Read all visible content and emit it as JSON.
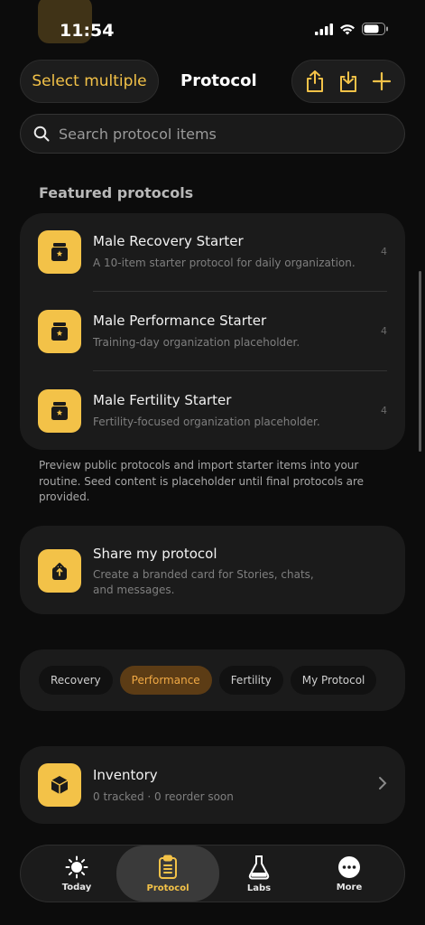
{
  "status": {
    "time": "11:54"
  },
  "header": {
    "select_label": "Select multiple",
    "title": "Protocol",
    "actions": [
      "share-icon",
      "download-icon",
      "plus-icon"
    ]
  },
  "search": {
    "placeholder": "Search protocol items"
  },
  "featured": {
    "title": "Featured protocols",
    "items": [
      {
        "name": "Male Recovery Starter",
        "desc": "A 10-item starter protocol for daily organization.",
        "count": "4"
      },
      {
        "name": "Male Performance Starter",
        "desc": "Training-day organization placeholder.",
        "count": "4"
      },
      {
        "name": "Male Fertility Starter",
        "desc": "Fertility-focused organization placeholder.",
        "count": "4"
      }
    ],
    "note": "Preview public protocols and import starter items into your routine. Seed content is placeholder until final protocols are provided."
  },
  "share": {
    "title": "Share my protocol",
    "desc": "Create a branded card for Stories, chats, and messages."
  },
  "filters": [
    "Recovery",
    "Performance",
    "Fertility",
    "My Protocol"
  ],
  "filters_active": "Performance",
  "inventory": {
    "title": "Inventory",
    "desc": "0 tracked · 0 reorder soon"
  },
  "tabs": [
    {
      "label": "Today",
      "icon": "sun-icon"
    },
    {
      "label": "Protocol",
      "icon": "clipboard-icon"
    },
    {
      "label": "Labs",
      "icon": "flask-icon"
    },
    {
      "label": "More",
      "icon": "more-icon"
    }
  ],
  "tabs_active": "Protocol",
  "colors": {
    "accent": "#f3c248",
    "chip_active_bg": "#5c3c15",
    "chip_active_text": "#f0a945",
    "background": "#0c0c0c",
    "card": "#1b1b1b"
  }
}
